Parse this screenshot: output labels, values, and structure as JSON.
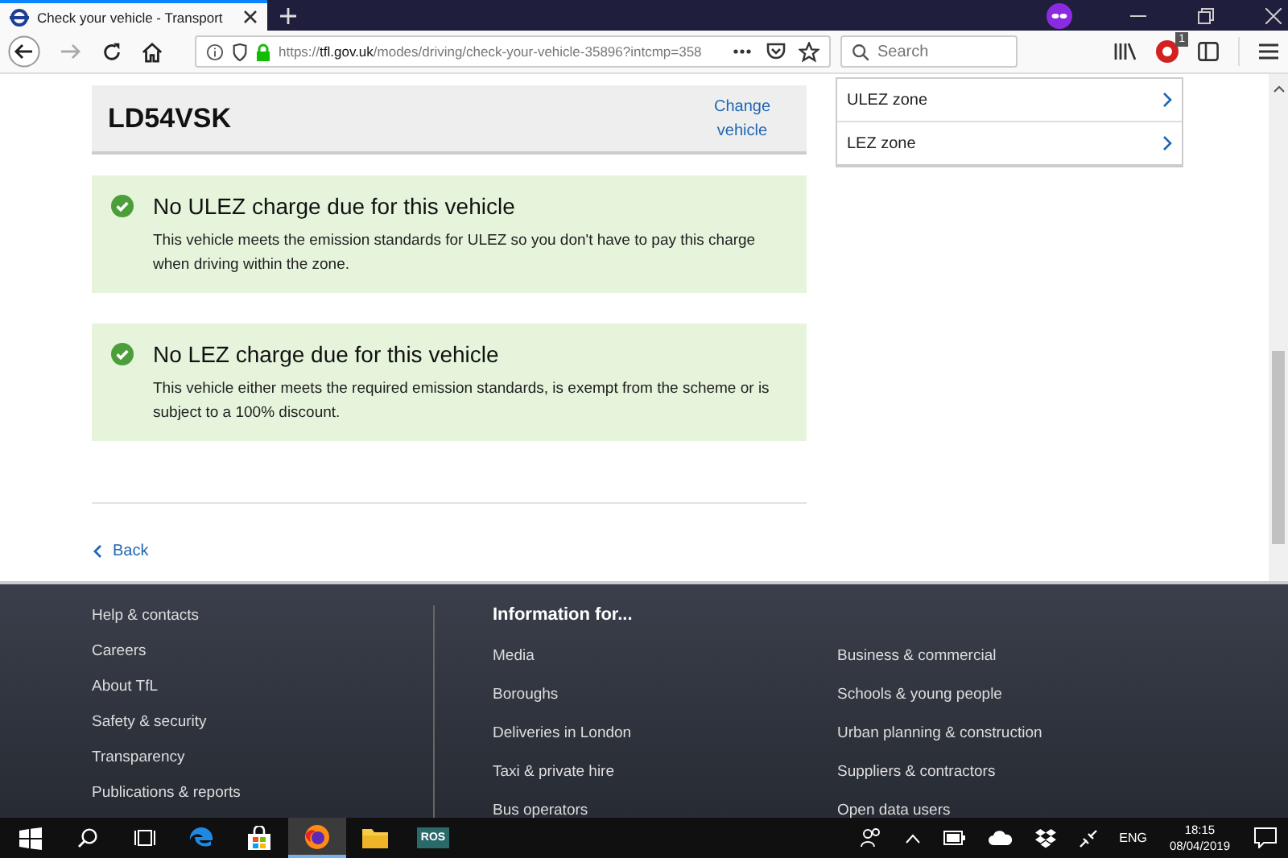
{
  "browser": {
    "tab_title": "Check your vehicle - Transport",
    "url": "https://**tfl.gov.uk**/modes/driving/check-your-vehicle-35896?intcmp=358",
    "search_placeholder": "Search",
    "extension_badge": "1"
  },
  "vehicle": {
    "registration": "LD54VSK",
    "change_link": "Change vehicle"
  },
  "results": [
    {
      "title": "No ULEZ charge due for this vehicle",
      "text": "This vehicle meets the emission standards for ULEZ so you don't have to pay this charge when driving within the zone."
    },
    {
      "title": "No LEZ charge due for this vehicle",
      "text": "This vehicle either meets the required emission standards, is exempt from the scheme or is subject to a 100% discount."
    }
  ],
  "zone_menu": [
    "ULEZ zone",
    "LEZ zone"
  ],
  "back_link": "Back",
  "footer": {
    "links": [
      "Help & contacts",
      "Careers",
      "About TfL",
      "Safety & security",
      "Transparency",
      "Publications & reports"
    ],
    "info_heading": "Information for...",
    "info_columns": [
      [
        "Media",
        "Boroughs",
        "Deliveries in London",
        "Taxi & private hire",
        "Bus operators"
      ],
      [
        "Business & commercial",
        "Schools & young people",
        "Urban planning & construction",
        "Suppliers & contractors",
        "Open data users"
      ]
    ]
  },
  "taskbar": {
    "apps": [
      {
        "kind": "edge",
        "selected": false
      },
      {
        "kind": "store",
        "selected": false
      },
      {
        "kind": "firefox",
        "selected": true
      },
      {
        "kind": "folder",
        "selected": false
      },
      {
        "kind": "label",
        "label": "ROS",
        "selected": false
      }
    ],
    "language": "ENG",
    "time": "18:15",
    "date": "08/04/2019"
  }
}
